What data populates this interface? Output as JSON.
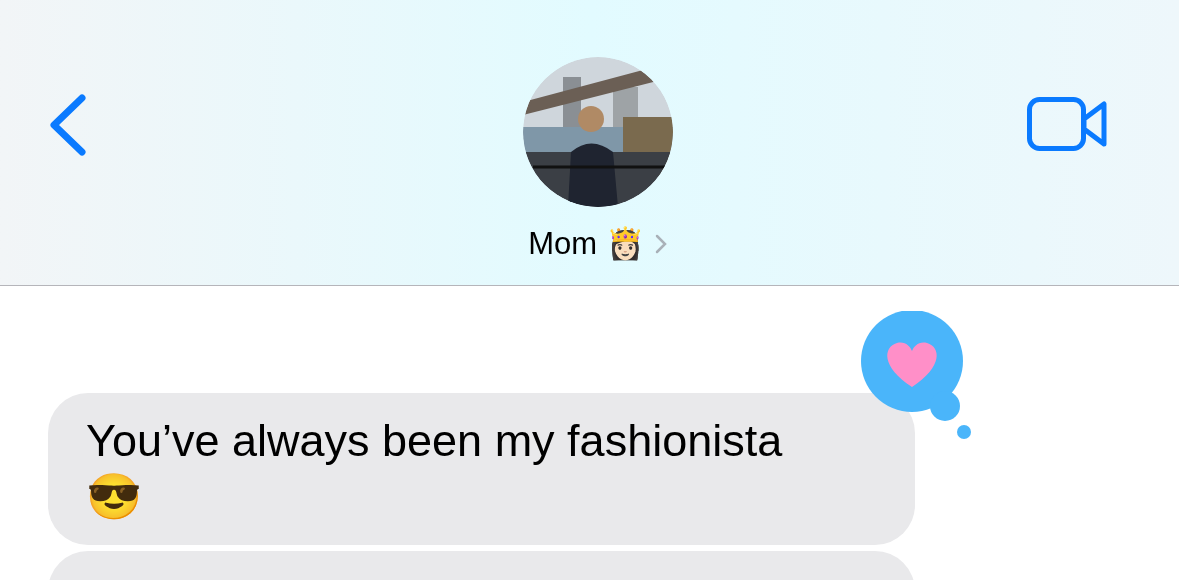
{
  "header": {
    "contact_name": "Mom 👸🏻"
  },
  "messages": [
    {
      "kind": "received",
      "text": "You’ve always been my fashionista 😎",
      "tapback": {
        "kind": "heart"
      }
    },
    {
      "kind": "received"
    }
  ]
}
